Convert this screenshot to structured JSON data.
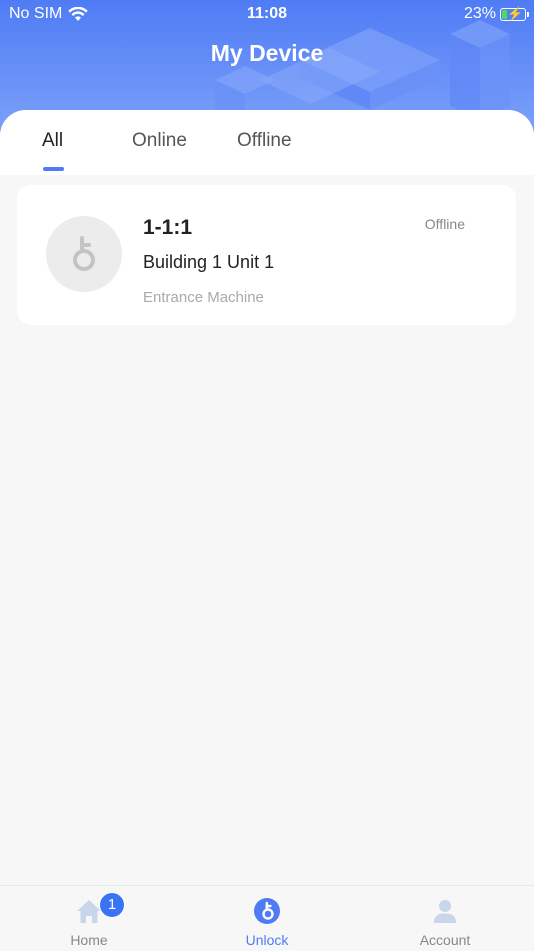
{
  "status_bar": {
    "carrier": "No SIM",
    "time": "11:08",
    "battery_percent": "23%",
    "battery_level": 0.23
  },
  "header": {
    "title": "My Device"
  },
  "tabs": [
    {
      "label": "All",
      "active": true
    },
    {
      "label": "Online",
      "active": false
    },
    {
      "label": "Offline",
      "active": false
    }
  ],
  "devices": [
    {
      "name": "1-1:1",
      "location": "Building 1 Unit 1",
      "type": "Entrance Machine",
      "status": "Offline",
      "icon": "key-icon"
    }
  ],
  "tabbar": {
    "items": [
      {
        "label": "Home",
        "icon": "home-icon",
        "badge": "1",
        "active": false
      },
      {
        "label": "Unlock",
        "icon": "unlock-icon",
        "active": true
      },
      {
        "label": "Account",
        "icon": "user-icon",
        "active": false
      }
    ]
  },
  "colors": {
    "accent": "#4f7cf5",
    "header_gradient_top": "#4f7cf5",
    "header_gradient_bottom": "#87a9fa",
    "badge": "#3b73f5"
  }
}
